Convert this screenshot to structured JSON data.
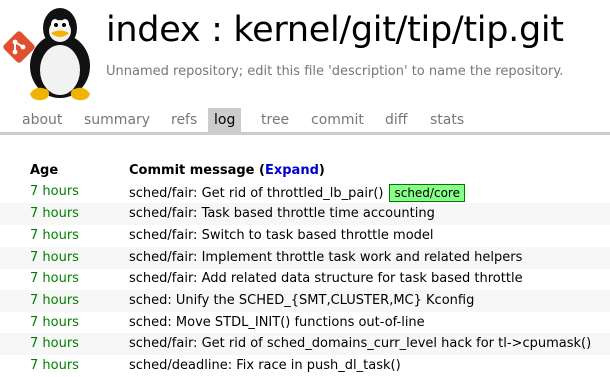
{
  "repo": {
    "title": "index : kernel/git/tip/tip.git",
    "description": "Unnamed repository; edit this file 'description' to name the repository."
  },
  "tabs": [
    {
      "label": "about"
    },
    {
      "label": "summary"
    },
    {
      "label": "refs"
    },
    {
      "label": "log"
    },
    {
      "label": "tree"
    },
    {
      "label": "commit"
    },
    {
      "label": "diff"
    },
    {
      "label": "stats"
    }
  ],
  "active_tab": "log",
  "table": {
    "header_age": "Age",
    "header_msg": "Commit message (",
    "expand_label": "Expand",
    "header_close": ")",
    "rows": [
      {
        "age": "7 hours",
        "message": "sched/fair: Get rid of throttled_lb_pair()",
        "decoration": "sched/core"
      },
      {
        "age": "7 hours",
        "message": "sched/fair: Task based throttle time accounting"
      },
      {
        "age": "7 hours",
        "message": "sched/fair: Switch to task based throttle model"
      },
      {
        "age": "7 hours",
        "message": "sched/fair: Implement throttle task work and related helpers"
      },
      {
        "age": "7 hours",
        "message": "sched/fair: Add related data structure for task based throttle"
      },
      {
        "age": "7 hours",
        "message": "sched: Unify the SCHED_{SMT,CLUSTER,MC} Kconfig"
      },
      {
        "age": "7 hours",
        "message": "sched: Move STDL_INIT() functions out-of-line"
      },
      {
        "age": "7 hours",
        "message": "sched/fair: Get rid of sched_domains_curr_level hack for tl->cpumask()"
      },
      {
        "age": "7 hours",
        "message": "sched/deadline: Fix race in push_dl_task()"
      }
    ]
  },
  "colors": {
    "age_green": "#008000",
    "decoration_bg": "#88ff88",
    "decoration_border": "#007700",
    "tab_active_bg": "#cccccc",
    "expand_link": "#0000cc"
  },
  "icons": {
    "logo": "tux-penguin-icon",
    "git": "git-logo-icon"
  }
}
